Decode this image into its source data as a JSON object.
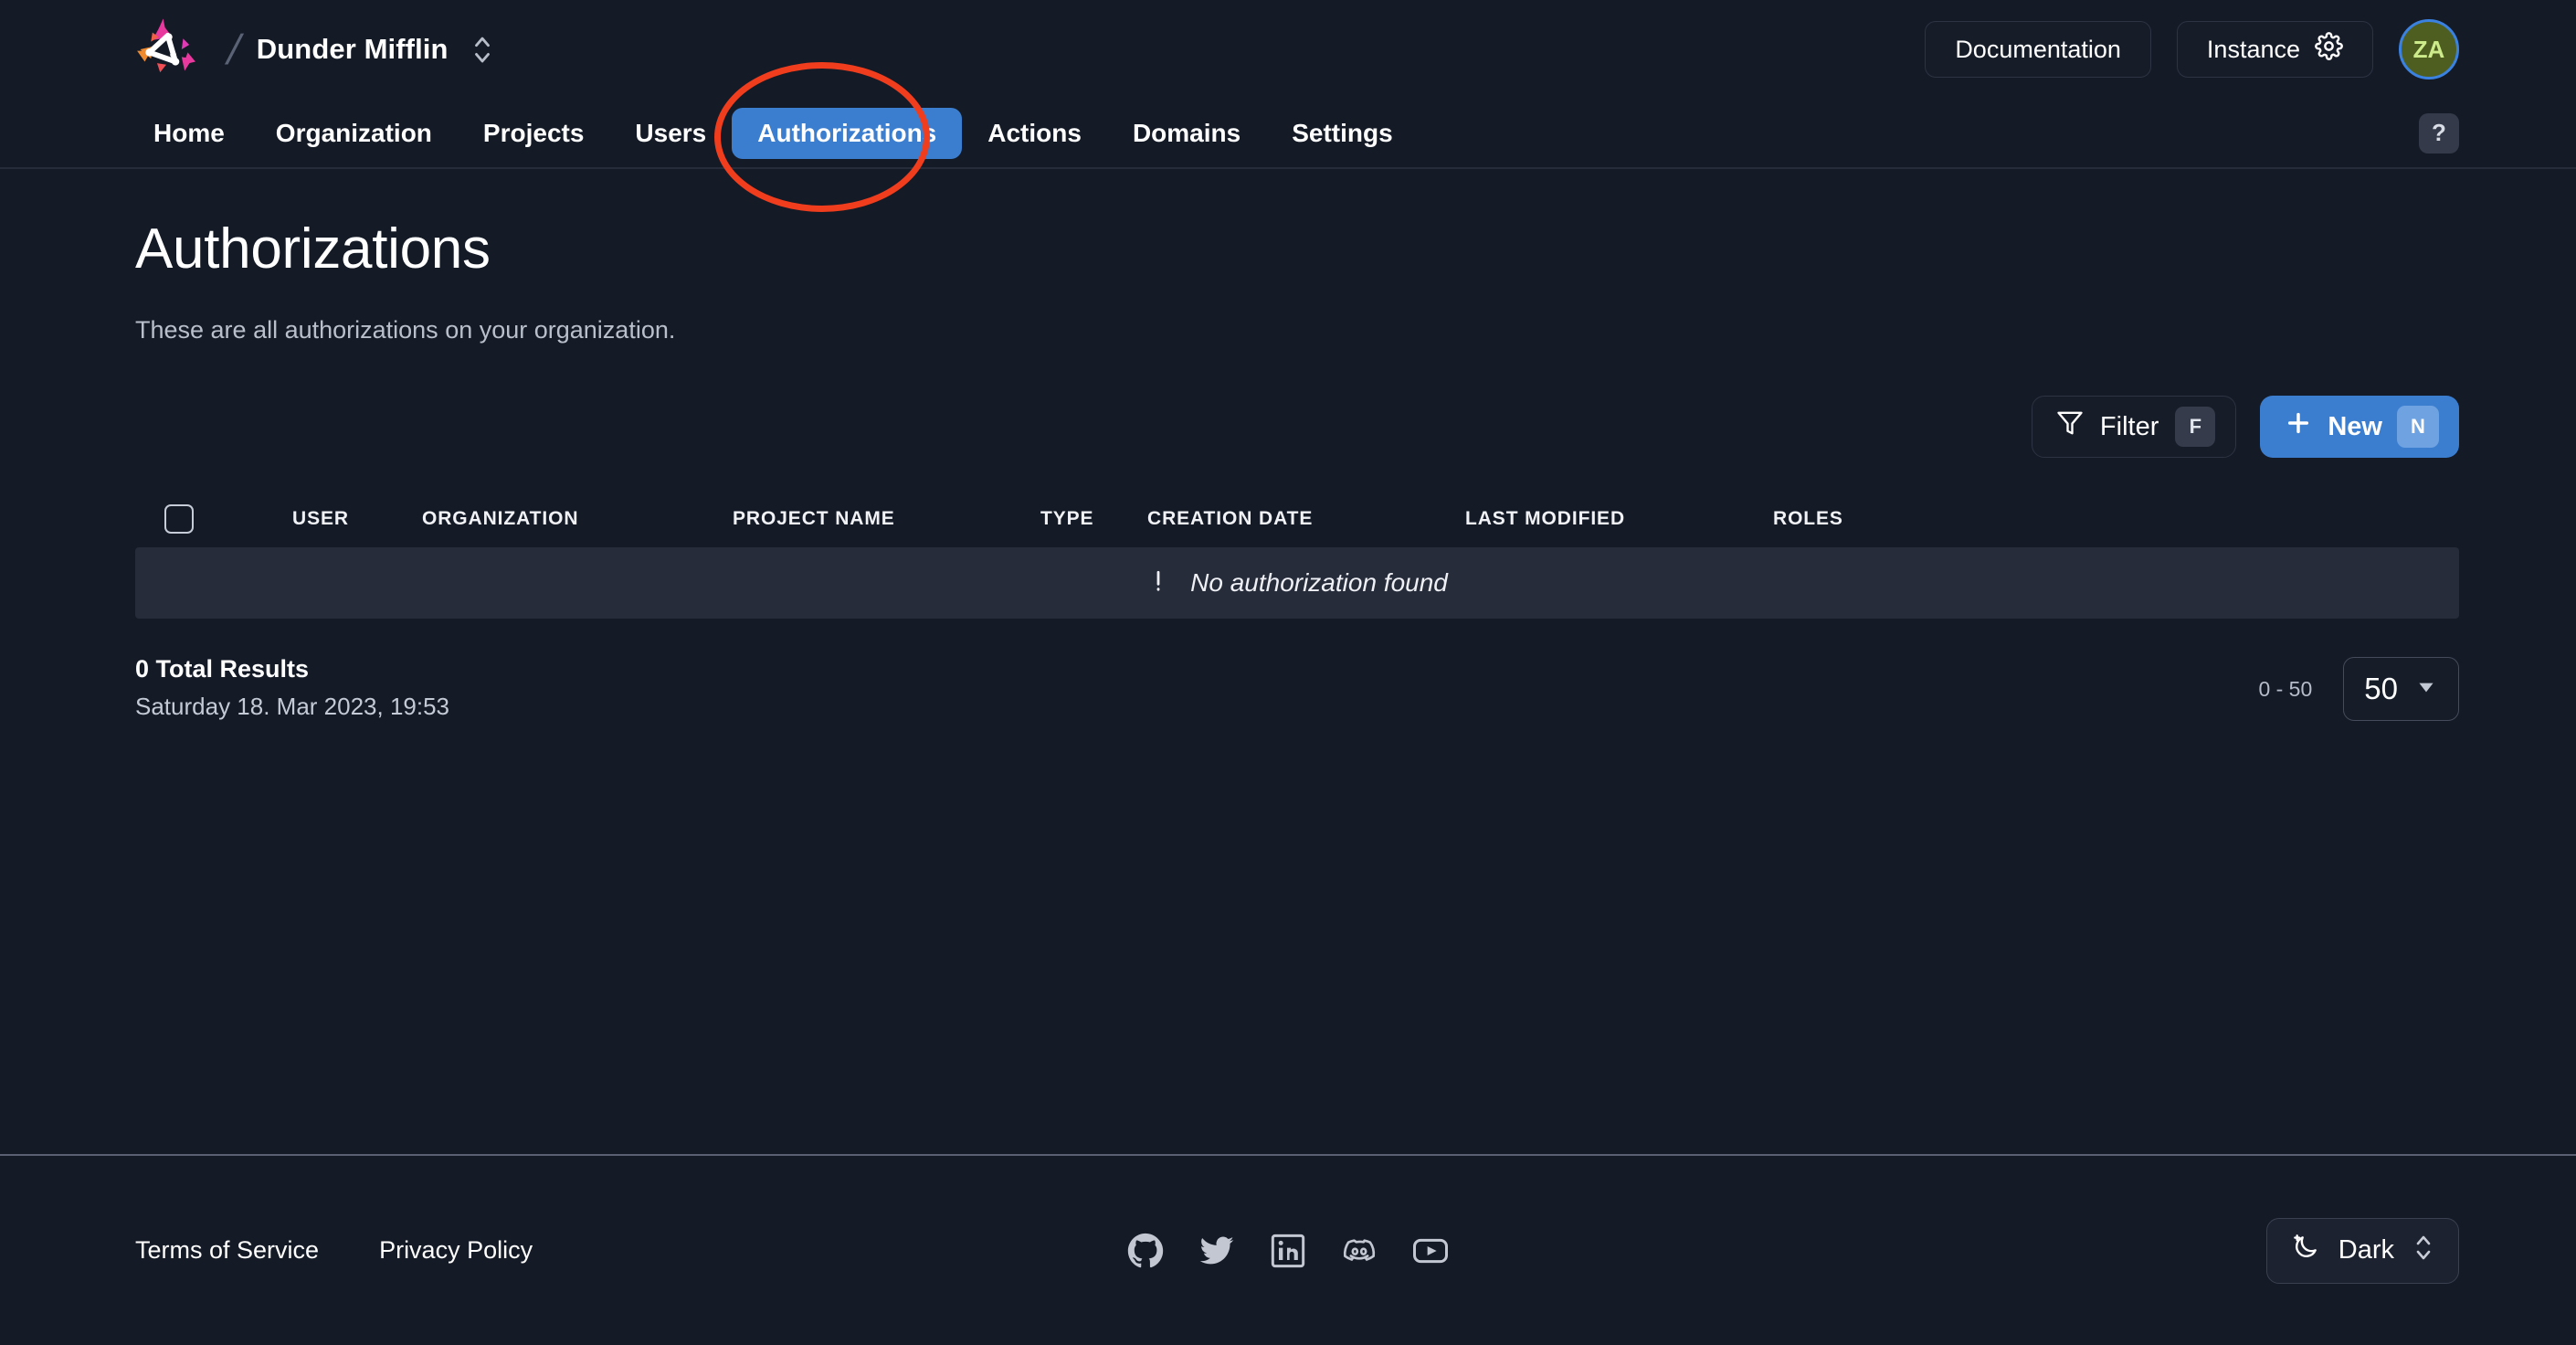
{
  "header": {
    "logo_icon": "nhost-triangle-logo",
    "separator": "/",
    "org_name": "Dunder Mifflin",
    "org_switcher_icon": "chevron-up-down-icon",
    "documentation_label": "Documentation",
    "instance_label": "Instance",
    "instance_icon": "gear-icon",
    "avatar_initials": "ZA",
    "avatar_bg": "#4e5e21",
    "avatar_text_color": "#cdeb8b",
    "avatar_border_color": "#3b82e0"
  },
  "nav": {
    "items": [
      {
        "label": "Home",
        "active": false
      },
      {
        "label": "Organization",
        "active": false
      },
      {
        "label": "Projects",
        "active": false
      },
      {
        "label": "Users",
        "active": false
      },
      {
        "label": "Authorizations",
        "active": true
      },
      {
        "label": "Actions",
        "active": false
      },
      {
        "label": "Domains",
        "active": false
      },
      {
        "label": "Settings",
        "active": false
      }
    ],
    "active_bg": "#3b7ed0",
    "help_label": "?"
  },
  "page": {
    "title": "Authorizations",
    "subtitle": "These are all authorizations on your organization."
  },
  "toolbar": {
    "filter_label": "Filter",
    "filter_icon": "funnel-icon",
    "filter_shortcut": "F",
    "new_label": "New",
    "new_icon": "plus-icon",
    "new_shortcut": "N",
    "new_bg": "#3b7ed0"
  },
  "table": {
    "select_all_checkbox": "unchecked",
    "columns": [
      "USER",
      "ORGANIZATION",
      "PROJECT NAME",
      "TYPE",
      "CREATION DATE",
      "LAST MODIFIED",
      "ROLES"
    ],
    "rows": [],
    "empty_icon": "exclamation-icon",
    "empty_message": "No authorization found"
  },
  "results": {
    "total_label": "0 Total Results",
    "timestamp": "Saturday 18. Mar 2023, 19:53",
    "range_label": "0 - 50",
    "per_page_value": "50",
    "per_page_icon": "chevron-down-icon"
  },
  "footer": {
    "terms_label": "Terms of Service",
    "privacy_label": "Privacy Policy",
    "socials": [
      "github-icon",
      "twitter-icon",
      "linkedin-icon",
      "discord-icon",
      "youtube-icon"
    ],
    "theme_label": "Dark",
    "theme_icon": "moon-star-icon",
    "theme_switcher_icon": "chevron-up-down-icon"
  },
  "annotation": {
    "shape": "ellipse-highlight",
    "target": "Authorizations",
    "color": "#ef3d1d"
  }
}
